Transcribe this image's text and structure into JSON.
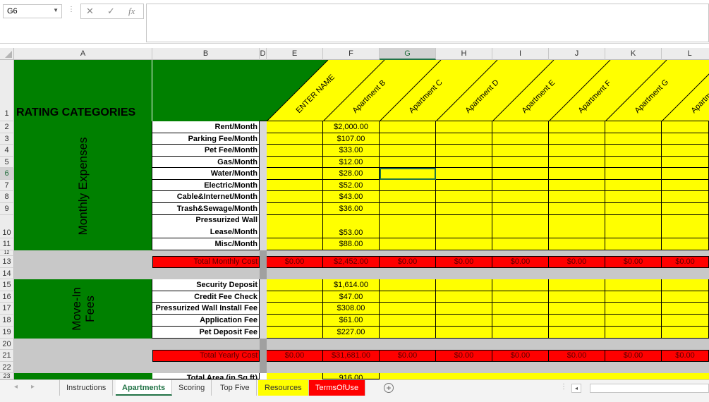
{
  "formula_bar": {
    "name_box": "G6",
    "cancel_icon": "close-icon",
    "enter_icon": "check-icon",
    "function_label": "fx",
    "formula": ""
  },
  "columns": [
    "A",
    "B",
    "D",
    "E",
    "F",
    "G",
    "H",
    "I",
    "J",
    "K",
    "L"
  ],
  "selected_column": "G",
  "header_row": {
    "title": "RATING CATEGORIES",
    "apartments": [
      "ENTER NAME",
      "Apartment B",
      "Apartment C",
      "Apartment D",
      "Apartment E",
      "Apartment F",
      "Apartment G",
      "Apartm"
    ]
  },
  "section_labels": {
    "monthly": "Monthly Expenses",
    "movein_line1": "Move-In",
    "movein_line2": "Fees"
  },
  "monthly_rows": [
    {
      "row": "2",
      "label": "Rent/Month",
      "f": "$2,000.00"
    },
    {
      "row": "3",
      "label": "Parking Fee/Month",
      "f": "$107.00"
    },
    {
      "row": "4",
      "label": "Pet Fee/Month",
      "f": "$33.00"
    },
    {
      "row": "5",
      "label": "Gas/Month",
      "f": "$12.00"
    },
    {
      "row": "6",
      "label": "Water/Month",
      "f": "$28.00"
    },
    {
      "row": "7",
      "label": "Electric/Month",
      "f": "$52.00"
    },
    {
      "row": "8",
      "label": "Cable&Internet/Month",
      "f": "$43.00"
    },
    {
      "row": "9",
      "label": "Trash&Sewage/Month",
      "f": "$36.00"
    },
    {
      "row": "10",
      "label": "Lease/Month",
      "label_top": "Pressurized Wall",
      "f": "$53.00"
    },
    {
      "row": "11",
      "label": "Misc/Month",
      "f": "$88.00"
    }
  ],
  "total_monthly": {
    "row": "13",
    "label": "Total Monthly Cost",
    "values": [
      "$0.00",
      "$2,452.00",
      "$0.00",
      "$0.00",
      "$0.00",
      "$0.00",
      "$0.00",
      "$0.00"
    ]
  },
  "movein_rows": [
    {
      "row": "15",
      "label": "Security Deposit",
      "f": "$1,614.00"
    },
    {
      "row": "16",
      "label": "Credit Fee Check",
      "f": "$47.00"
    },
    {
      "row": "17",
      "label": "Pressurized Wall Install Fee",
      "f": "$308.00"
    },
    {
      "row": "18",
      "label": "Application Fee",
      "f": "$61.00"
    },
    {
      "row": "19",
      "label": "Pet Deposit Fee",
      "f": "$227.00"
    }
  ],
  "total_yearly": {
    "row": "21",
    "label": "Total Yearly Cost",
    "values": [
      "$0.00",
      "$31,681.00",
      "$0.00",
      "$0.00",
      "$0.00",
      "$0.00",
      "$0.00",
      "$0.00"
    ]
  },
  "row_numbers_other": {
    "r1": "1",
    "r12": "12",
    "r14": "14",
    "r20": "20",
    "r22": "22",
    "r23": "23"
  },
  "row23": {
    "label": "Total Area (in Sq ft)",
    "f": "916.00"
  },
  "tabs": [
    "Instructions",
    "Apartments",
    "Scoring",
    "Top Five",
    "Resources",
    "TermsOfUse"
  ],
  "active_tab": "Apartments",
  "colors": {
    "green": "#008000",
    "yellow": "#ffff00",
    "red": "#ff0000",
    "gray": "#c8c8c8",
    "excel_green": "#217346"
  }
}
